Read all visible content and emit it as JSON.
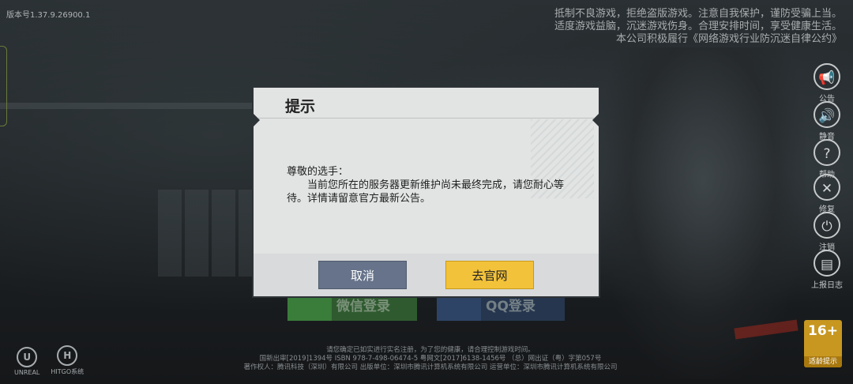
{
  "version": "版本号1.37.9.26900.1",
  "notice": {
    "line1": "抵制不良游戏，拒绝盗版游戏。注意自我保护，谨防受骗上当。",
    "line2": "适度游戏益脑，沉迷游戏伤身。合理安排时间，享受健康生活。",
    "line3": "本公司积极履行《网络游戏行业防沉迷自律公约》"
  },
  "sidebar": {
    "items": [
      {
        "label": "公告",
        "icon": "megaphone-icon",
        "glyph": "📢"
      },
      {
        "label": "静音",
        "icon": "speaker-icon",
        "glyph": "🔊"
      },
      {
        "label": "帮助",
        "icon": "question-icon",
        "glyph": "?"
      },
      {
        "label": "修复",
        "icon": "wrench-icon",
        "glyph": "✕"
      },
      {
        "label": "注销",
        "icon": "power-icon",
        "glyph": "⏻"
      },
      {
        "label": "上报日志",
        "icon": "log-upload-icon",
        "glyph": "▤"
      }
    ]
  },
  "login": {
    "wechat": "微信登录",
    "qq": "QQ登录"
  },
  "dialog": {
    "title": "提示",
    "greeting": "尊敬的选手：",
    "message": "当前您所在的服务器更新维护尚未最终完成，请您耐心等待。详情请留意官方最新公告。",
    "cancel": "取消",
    "confirm": "去官网"
  },
  "footer": {
    "line1": "请您确定已如实进行实名注册，为了您的健康，请合理控制游戏时间。",
    "line2": "国新出审[2019]1394号  ISBN 978-7-498-06474-5  粤网文[2017]6138-1456号  （总）网出证（粤）字第057号",
    "line3": "著作权人：腾讯科技（深圳）有限公司   出版单位：深圳市腾讯计算机系统有限公司   运营单位：深圳市腾讯计算机系统有限公司"
  },
  "logos": {
    "unreal": "UNREAL",
    "unreal_mark": "U",
    "hitgo": "HITGO系统",
    "hitgo_mark": "H"
  },
  "age_rating": {
    "value": "16+",
    "label": "适龄提示",
    "color": "#c79720"
  }
}
